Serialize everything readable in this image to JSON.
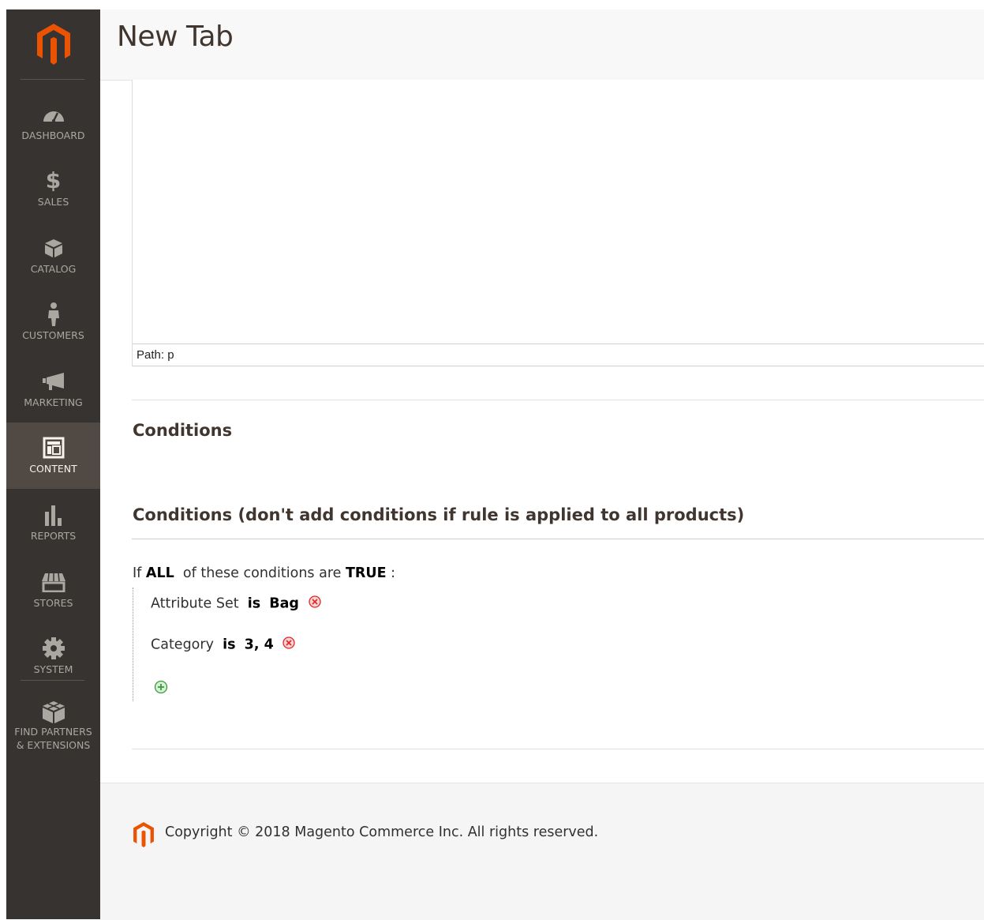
{
  "sidebar": {
    "items": [
      {
        "label": "DASHBOARD",
        "icon": "dashboard-icon",
        "active": false
      },
      {
        "label": "SALES",
        "icon": "dollar-icon",
        "active": false
      },
      {
        "label": "CATALOG",
        "icon": "box-icon",
        "active": false
      },
      {
        "label": "CUSTOMERS",
        "icon": "person-icon",
        "active": false
      },
      {
        "label": "MARKETING",
        "icon": "megaphone-icon",
        "active": false
      },
      {
        "label": "CONTENT",
        "icon": "layout-icon",
        "active": true
      },
      {
        "label": "REPORTS",
        "icon": "bar-chart-icon",
        "active": false
      },
      {
        "label": "STORES",
        "icon": "store-icon",
        "active": false
      },
      {
        "label": "SYSTEM",
        "icon": "gear-icon",
        "active": false
      },
      {
        "label": "FIND PARTNERS & EXTENSIONS",
        "icon": "cubes-icon",
        "active": false
      }
    ]
  },
  "header": {
    "title": "New Tab"
  },
  "editor": {
    "path": "Path: p"
  },
  "conditions": {
    "title": "Conditions",
    "subtitle": "Conditions (don't add conditions if rule is applied to all products)",
    "if_word": "If",
    "aggregator": "ALL",
    "middle_text": "of these conditions are",
    "value": "TRUE",
    "colon": ":",
    "rules": [
      {
        "attribute": "Attribute Set",
        "operator": "is",
        "value": "Bag"
      },
      {
        "attribute": "Category",
        "operator": "is",
        "value": "3, 4"
      }
    ]
  },
  "footer": {
    "copyright": "Copyright © 2018 Magento Commerce Inc. All rights reserved."
  },
  "colors": {
    "brand_orange": "#eb5202",
    "sidebar_bg": "#373330",
    "sidebar_active": "#514943",
    "remove_red": "#e22626",
    "add_green": "#3b9a3b"
  }
}
